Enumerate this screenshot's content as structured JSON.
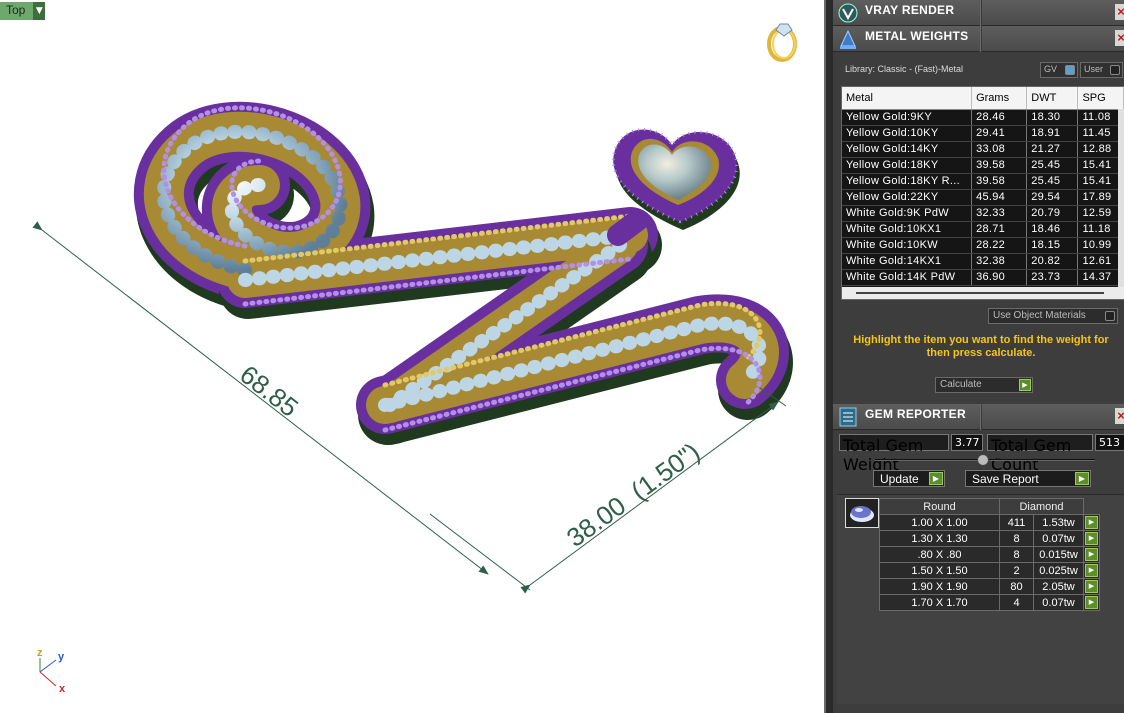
{
  "viewport": {
    "view_label": "Top",
    "dim_long": "68.85",
    "dim_short": "38.00  (1.50\")",
    "axis_x": "x",
    "axis_y": "y",
    "axis_z": "z"
  },
  "vray": {
    "title": "VRAY RENDER",
    "close": "×"
  },
  "metal_weights": {
    "title": "METAL WEIGHTS",
    "close": "×",
    "library": "Library: Classic - (Fast)-Metal",
    "toggle_gv": "GV",
    "toggle_user": "User",
    "columns": [
      "Metal",
      "Grams",
      "DWT",
      "SPG"
    ],
    "rows": [
      [
        "Yellow Gold:9KY",
        "28.46",
        "18.30",
        "11.08"
      ],
      [
        "Yellow Gold:10KY",
        "29.41",
        "18.91",
        "11.45"
      ],
      [
        "Yellow Gold:14KY",
        "33.08",
        "21.27",
        "12.88"
      ],
      [
        "Yellow Gold:18KY",
        "39.58",
        "25.45",
        "15.41"
      ],
      [
        "Yellow Gold:18KY R...",
        "39.58",
        "25.45",
        "15.41"
      ],
      [
        "Yellow Gold:22KY",
        "45.94",
        "29.54",
        "17.89"
      ],
      [
        "White Gold:9K PdW",
        "32.33",
        "20.79",
        "12.59"
      ],
      [
        "White Gold:10KX1",
        "28.71",
        "18.46",
        "11.18"
      ],
      [
        "White Gold:10KW",
        "28.22",
        "18.15",
        "10.99"
      ],
      [
        "White Gold:14KX1",
        "32.38",
        "20.82",
        "12.61"
      ],
      [
        "White Gold:14K PdW",
        "36.90",
        "23.73",
        "14.37"
      ]
    ],
    "use_object_materials": "Use Object Materials",
    "hint": "Highlight the item you want to find the weight for then press calculate.",
    "calculate": "Calculate"
  },
  "gem_reporter": {
    "title": "GEM REPORTER",
    "close": "×",
    "total_weight_label": "Total Gem Weight",
    "total_weight_value": "3.77",
    "total_count_label": "Total Gem Count",
    "total_count_value": "513",
    "update": "Update",
    "save_report": "Save Report",
    "columns": [
      "Round",
      "Diamond"
    ],
    "rows": [
      [
        "1.00 X 1.00",
        "411",
        "1.53tw"
      ],
      [
        "1.30 X 1.30",
        "8",
        "0.07tw"
      ],
      [
        ".80 X .80",
        "8",
        "0.015tw"
      ],
      [
        "1.50 X 1.50",
        "2",
        "0.025tw"
      ],
      [
        "1.90 X 1.90",
        "80",
        "2.05tw"
      ],
      [
        "1.70 X 1.70",
        "4",
        "0.07tw"
      ]
    ]
  },
  "colors": {
    "metal_purple": "#6a2f9e",
    "metal_gold": "#c9a640",
    "gem_blue": "#9ec3da",
    "dimension_line": "#2f5f4a",
    "hint_yellow": "#f5c518",
    "go_green": "#5c8d2c"
  }
}
